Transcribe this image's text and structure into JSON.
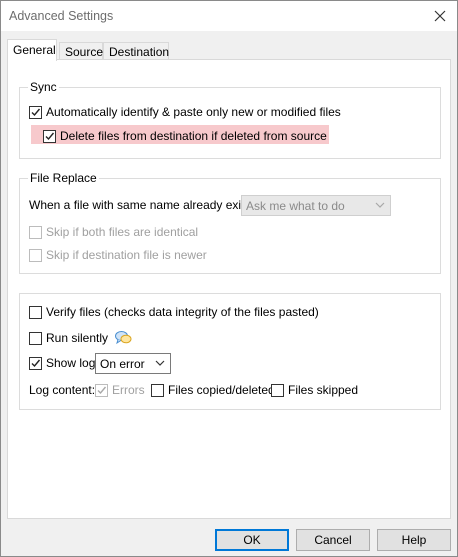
{
  "window": {
    "title": "Advanced Settings"
  },
  "tabs": [
    {
      "label": "General",
      "active": true
    },
    {
      "label": "Source",
      "active": false
    },
    {
      "label": "Destination",
      "active": false
    }
  ],
  "sync": {
    "title": "Sync",
    "auto_identify": {
      "label": "Automatically identify & paste only new or modified files",
      "checked": true
    },
    "delete_files": {
      "label": "Delete files from destination if deleted from source",
      "checked": true
    }
  },
  "file_replace": {
    "title": "File Replace",
    "prompt_label": "When a file with same name already exists:",
    "prompt_value": "Ask me what to do",
    "skip_identical": {
      "label": "Skip if both files are identical",
      "checked": false,
      "enabled": false
    },
    "skip_newer": {
      "label": "Skip if destination file is newer",
      "checked": false,
      "enabled": false
    }
  },
  "options": {
    "verify": {
      "label": "Verify files (checks data integrity of the files pasted)",
      "checked": false
    },
    "run_silently": {
      "label": "Run silently",
      "checked": false
    },
    "show_log": {
      "label": "Show log",
      "checked": true
    },
    "log_mode_value": "On error",
    "log_content_label": "Log content:",
    "errors": {
      "label": "Errors",
      "checked": true,
      "enabled": false
    },
    "files_copied": {
      "label": "Files copied/deleted",
      "checked": false
    },
    "files_skipped": {
      "label": "Files skipped",
      "checked": false
    }
  },
  "buttons": {
    "ok": "OK",
    "cancel": "Cancel",
    "help": "Help"
  },
  "colors": {
    "highlight": "#f7c9cc",
    "default_button_border": "#0078d7"
  }
}
